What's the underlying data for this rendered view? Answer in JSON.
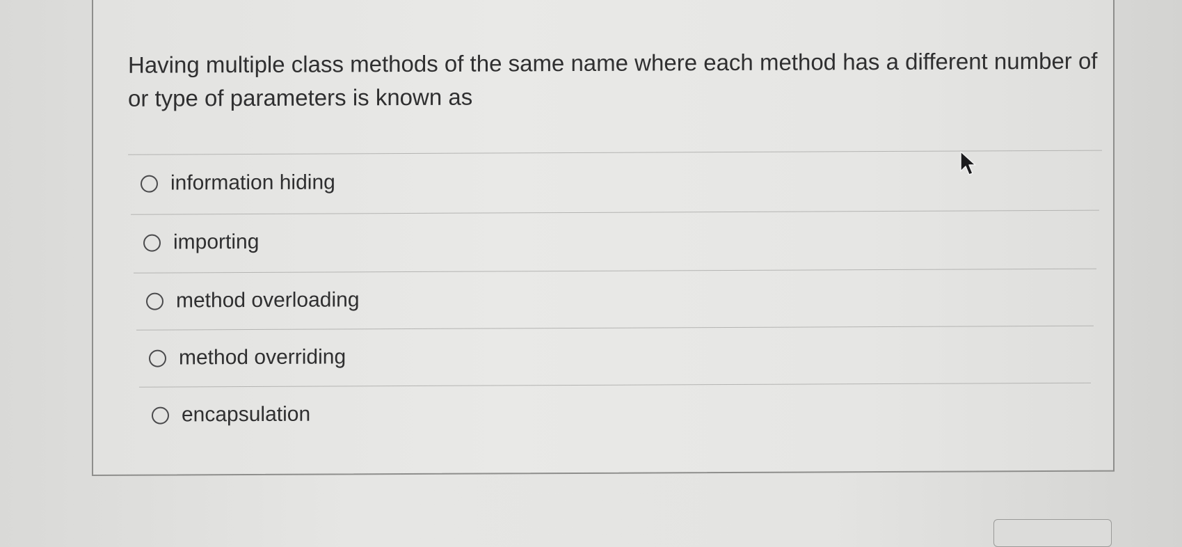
{
  "question": {
    "text": "Having multiple class methods of the same name where each method has a different number of or type of parameters is known as"
  },
  "options": [
    {
      "label": "information hiding",
      "selected": false
    },
    {
      "label": "importing",
      "selected": false
    },
    {
      "label": "method overloading",
      "selected": false
    },
    {
      "label": "method overriding",
      "selected": false
    },
    {
      "label": "encapsulation",
      "selected": false
    }
  ],
  "icons": {
    "cursor": "mouse-pointer-arrow-icon",
    "radio": "radio-unselected-icon"
  }
}
